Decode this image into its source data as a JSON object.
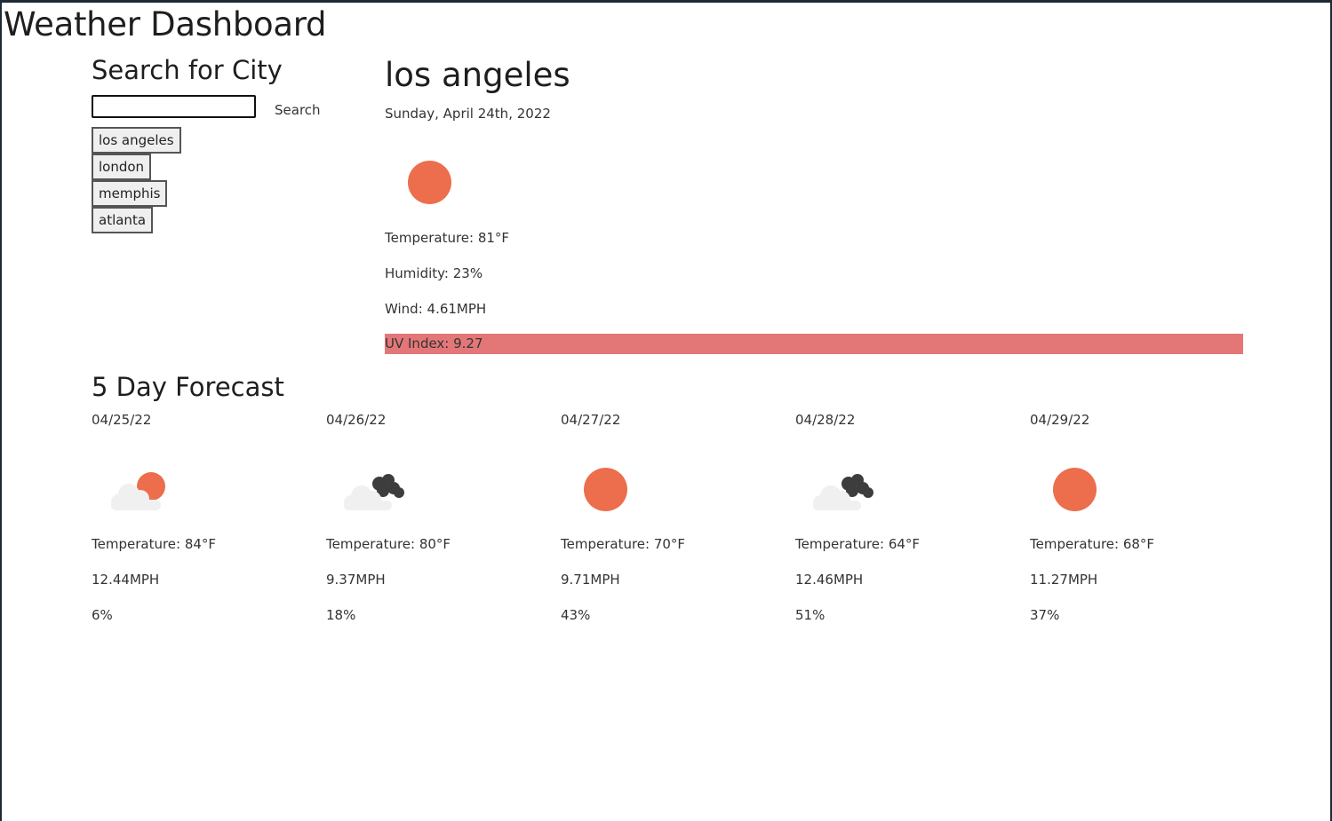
{
  "app": {
    "title": "Weather Dashboard"
  },
  "search": {
    "heading": "Search for City",
    "input_value": "",
    "input_placeholder": "",
    "button_label": "Search",
    "history": [
      "los angeles",
      "london",
      "memphis",
      "atlanta"
    ]
  },
  "current": {
    "city": "los angeles",
    "date": "Sunday, April 24th, 2022",
    "icon": "sun-icon",
    "temperature": "Temperature: 81°F",
    "humidity": "Humidity: 23%",
    "wind": "Wind: 4.61MPH",
    "uv_index": "UV Index: 9.27",
    "uv_color": "#e37778",
    "sun_color": "#ec6e4c"
  },
  "forecast": {
    "heading": "5 Day Forecast",
    "days": [
      {
        "date": "04/25/22",
        "icon": "cloud-sun-icon",
        "temperature": "Temperature: 84°F",
        "wind": "12.44MPH",
        "humidity": "6%"
      },
      {
        "date": "04/26/22",
        "icon": "dark-cloud-icon",
        "temperature": "Temperature: 80°F",
        "wind": "9.37MPH",
        "humidity": "18%"
      },
      {
        "date": "04/27/22",
        "icon": "sun-icon",
        "temperature": "Temperature: 70°F",
        "wind": "9.71MPH",
        "humidity": "43%"
      },
      {
        "date": "04/28/22",
        "icon": "dark-cloud-icon",
        "temperature": "Temperature: 64°F",
        "wind": "12.46MPH",
        "humidity": "51%"
      },
      {
        "date": "04/29/22",
        "icon": "sun-icon",
        "temperature": "Temperature: 68°F",
        "wind": "11.27MPH",
        "humidity": "37%"
      }
    ]
  }
}
